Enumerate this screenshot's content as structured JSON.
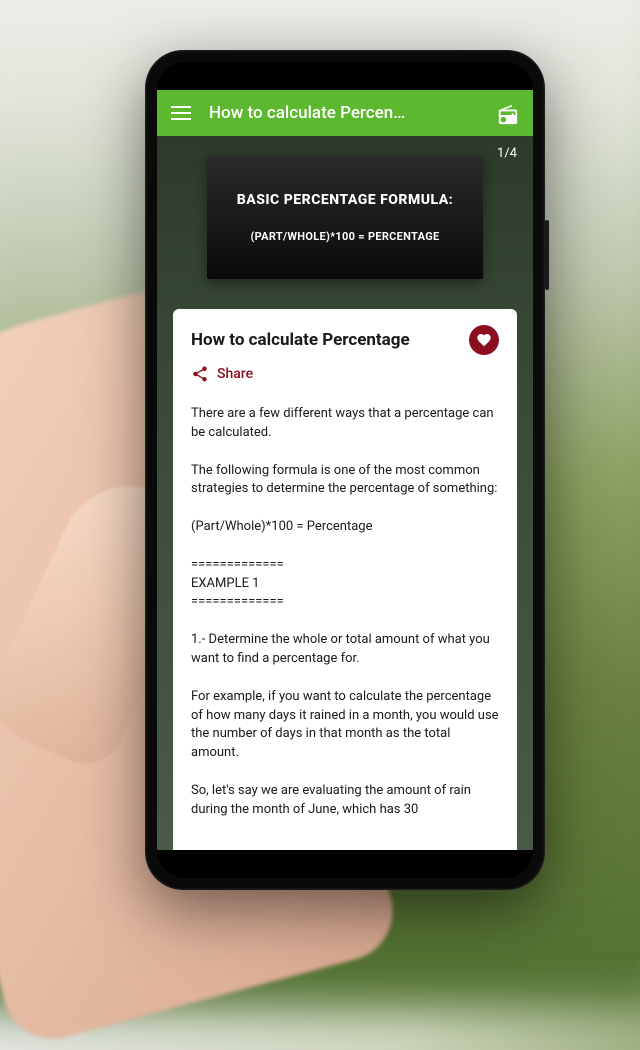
{
  "appBar": {
    "title": "How to calculate Percen…"
  },
  "hero": {
    "counter": "1/4",
    "formulaTitle": "BASIC PERCENTAGE FORMULA:",
    "formulaText": "(PART/WHOLE)*100 = PERCENTAGE"
  },
  "card": {
    "title": "How to calculate Percentage",
    "shareLabel": "Share",
    "body": "There are a few different ways that a percentage can be calculated.\n\nThe following formula is one of the most common strategies to determine the percentage of something:\n\n(Part/Whole)*100 = Percentage\n\n=============\nEXAMPLE 1\n=============\n\n1.- Determine the whole or total amount of what you want to find a percentage for.\n\nFor example, if you want to calculate the percentage of how many days it rained in a month, you would use the number of days in that month as the total amount.\n\nSo, let's say we are evaluating the amount of rain during the month of June, which has 30"
  },
  "colors": {
    "primary": "#5cb82e",
    "accent": "#8a0e1e"
  }
}
